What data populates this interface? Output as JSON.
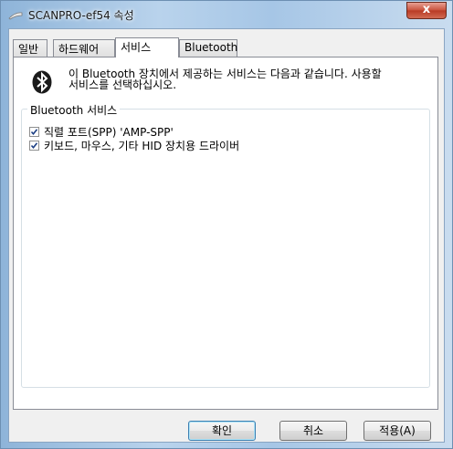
{
  "window": {
    "title": "SCANPRO-ef54 속성",
    "close_label": "x"
  },
  "tabs": [
    {
      "label": "일반",
      "active": false
    },
    {
      "label": "하드웨어",
      "active": false
    },
    {
      "label": "서비스",
      "active": true
    },
    {
      "label": "Bluetooth",
      "active": false
    }
  ],
  "panel": {
    "description_line1": "이 Bluetooth 장치에서 제공하는 서비스는 다음과 같습니다. 사용할",
    "description_line2": "서비스를 선택하십시오.",
    "bluetooth_icon": "bluetooth-icon",
    "group_label": "Bluetooth 서비스",
    "services": [
      {
        "label": "직렬 포트(SPP) 'AMP-SPP'",
        "checked": true
      },
      {
        "label": "키보드, 마우스, 기타 HID 장치용 드라이버",
        "checked": true
      }
    ]
  },
  "buttons": {
    "ok": "확인",
    "cancel": "취소",
    "apply": "적용(A)"
  },
  "colors": {
    "bluetooth_icon_bg": "#1b1b1b",
    "close_button": "#c8503a",
    "title_bar": "#a6c6e6"
  }
}
